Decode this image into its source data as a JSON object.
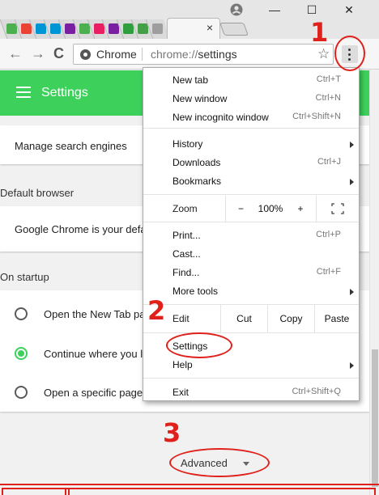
{
  "window": {
    "tabs": [
      {
        "icon": "maps-icon",
        "color": "#4caf50"
      },
      {
        "icon": "google-icon",
        "color": "#ea4335"
      },
      {
        "icon": "hp-icon",
        "color": "#0096d6"
      },
      {
        "icon": "hp-icon",
        "color": "#0096d6"
      },
      {
        "icon": "chart-icon",
        "color": "#7b1fa2"
      },
      {
        "icon": "maps-icon",
        "color": "#4caf50"
      },
      {
        "icon": "windows-icon",
        "color": "#e91e63"
      },
      {
        "icon": "chart-icon",
        "color": "#7b1fa2"
      },
      {
        "icon": "download-icon",
        "color": "#2e9e3e"
      },
      {
        "icon": "dollar-icon",
        "color": "#43a047"
      },
      {
        "icon": "document-icon",
        "color": "#9e9e9e"
      }
    ],
    "active_tab_close": "×",
    "minimize": "—",
    "maximize": "☐",
    "close": "✕"
  },
  "toolbar": {
    "back": "←",
    "forward": "→",
    "reload": "C",
    "site_chip": "Chrome",
    "url_scheme": "chrome://",
    "url_path": "settings",
    "star": "☆"
  },
  "settings": {
    "title": "Settings",
    "manage_search_engines": "Manage search engines",
    "default_browser_title": "Default browser",
    "default_browser_text": "Google Chrome is your defa",
    "on_startup_title": "On startup",
    "startup_options": [
      {
        "label": "Open the New Tab pa",
        "selected": false
      },
      {
        "label": "Continue where you l",
        "selected": true
      },
      {
        "label": "Open a specific page",
        "selected": false
      }
    ],
    "advanced": "Advanced"
  },
  "menu": {
    "new_tab": {
      "label": "New tab",
      "shortcut": "Ctrl+T"
    },
    "new_window": {
      "label": "New window",
      "shortcut": "Ctrl+N"
    },
    "new_incognito": {
      "label": "New incognito window",
      "shortcut": "Ctrl+Shift+N"
    },
    "history": {
      "label": "History"
    },
    "downloads": {
      "label": "Downloads",
      "shortcut": "Ctrl+J"
    },
    "bookmarks": {
      "label": "Bookmarks"
    },
    "zoom": {
      "label": "Zoom",
      "minus": "−",
      "value": "100%",
      "plus": "+"
    },
    "print": {
      "label": "Print...",
      "shortcut": "Ctrl+P"
    },
    "cast": {
      "label": "Cast..."
    },
    "find": {
      "label": "Find...",
      "shortcut": "Ctrl+F"
    },
    "more_tools": {
      "label": "More tools"
    },
    "edit": {
      "label": "Edit",
      "cut": "Cut",
      "copy": "Copy",
      "paste": "Paste"
    },
    "settings": {
      "label": "Settings"
    },
    "help": {
      "label": "Help"
    },
    "exit": {
      "label": "Exit",
      "shortcut": "Ctrl+Shift+Q"
    }
  },
  "annotations": {
    "step1": "1",
    "step2": "2",
    "step3": "3",
    "color": "#e0201b"
  }
}
